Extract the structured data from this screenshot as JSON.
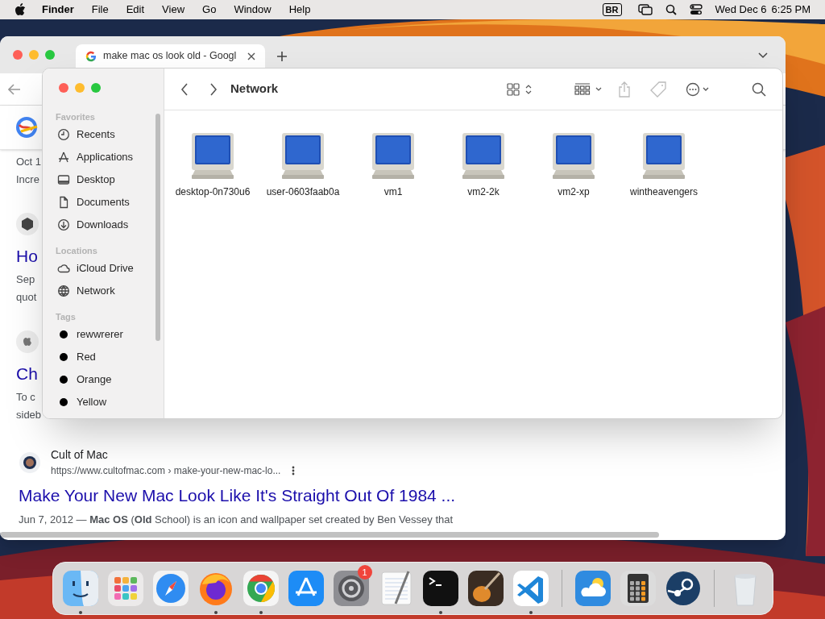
{
  "menu_bar": {
    "app": "Finder",
    "menus": [
      "File",
      "Edit",
      "View",
      "Go",
      "Window",
      "Help"
    ],
    "input_source": "BR",
    "date": "Wed Dec 6",
    "time": "6:25 PM"
  },
  "browser": {
    "tab": {
      "title": "make mac os look old - Googl"
    },
    "cut_results": [
      {
        "kind": "plain",
        "lines": [
          "Oct 1",
          "Incre"
        ]
      },
      {
        "kind": "cube_site",
        "title": "Ho",
        "lines": [
          "Sep",
          "quot"
        ]
      },
      {
        "kind": "apple_site",
        "title": "Ch",
        "lines": [
          "To c",
          "sideb"
        ]
      }
    ],
    "result": {
      "site": "Cult of Mac",
      "url": "https://www.cultofmac.com › make-your-new-mac-lo...",
      "title": "Make Your New Mac Look Like It's Straight Out Of 1984 ...",
      "snippet": "Jun 7, 2012 — **Mac OS** (**Old** School) is an icon and wallpaper set created by Ben Vessey that"
    }
  },
  "finder": {
    "title": "Network",
    "sidebar": [
      {
        "heading": "Favorites",
        "items": [
          {
            "label": "Recents",
            "kind": "clock"
          },
          {
            "label": "Applications",
            "kind": "apps"
          },
          {
            "label": "Desktop",
            "kind": "desktop"
          },
          {
            "label": "Documents",
            "kind": "document"
          },
          {
            "label": "Downloads",
            "kind": "download"
          }
        ]
      },
      {
        "heading": "Locations",
        "items": [
          {
            "label": "iCloud Drive",
            "kind": "cloud"
          },
          {
            "label": "Network",
            "kind": "globe"
          }
        ]
      },
      {
        "heading": "Tags",
        "items": [
          {
            "label": "rewwrerer",
            "kind": "tag"
          },
          {
            "label": "Red",
            "kind": "tag"
          },
          {
            "label": "Orange",
            "kind": "tag"
          },
          {
            "label": "Yellow",
            "kind": "tag"
          }
        ]
      }
    ],
    "items": [
      "desktop-0n730u6",
      "user-0603faab0a",
      "vm1",
      "vm2-2k",
      "vm2-xp",
      "wintheavengers"
    ]
  },
  "dock": {
    "apps": [
      {
        "kind": "finder",
        "running": true
      },
      {
        "kind": "launchpad",
        "running": false
      },
      {
        "kind": "safari",
        "running": false
      },
      {
        "kind": "firefox",
        "running": true
      },
      {
        "kind": "chrome",
        "running": true
      },
      {
        "kind": "appstore",
        "running": false
      },
      {
        "kind": "settings",
        "running": false,
        "badge": "1"
      },
      {
        "kind": "textedit",
        "running": false
      },
      {
        "kind": "terminal",
        "running": true
      },
      {
        "kind": "guitar",
        "running": false
      },
      {
        "kind": "vscode",
        "running": true
      },
      {
        "kind": "separator"
      },
      {
        "kind": "weather",
        "running": false
      },
      {
        "kind": "calculator",
        "running": false
      },
      {
        "kind": "steam",
        "running": false
      },
      {
        "kind": "separator"
      },
      {
        "kind": "trash",
        "running": false
      }
    ]
  }
}
